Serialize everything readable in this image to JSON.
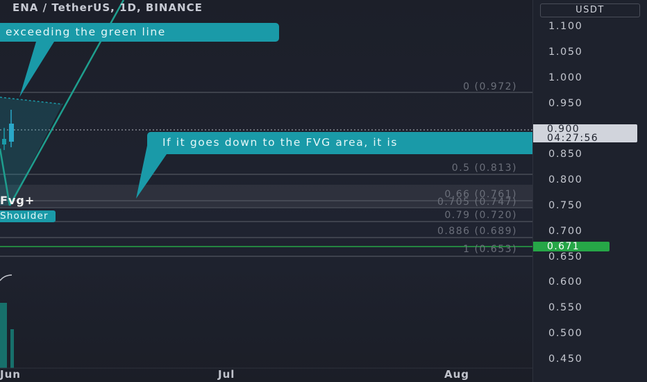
{
  "header": {
    "title": "ENA / TetherUS, 1D, BINANCE"
  },
  "annotations": {
    "bubble_top": "exceeding the green line",
    "bubble_fvg": "If it goes down to the FVG area, it is",
    "fvg_label": "Fvg+",
    "shoulder_label": "Shoulder"
  },
  "fib_levels": [
    {
      "label": "0 (0.972)",
      "price": 0.972
    },
    {
      "label": "0.5 (0.813)",
      "price": 0.813
    },
    {
      "label": "0.66 (0.761)",
      "price": 0.761
    },
    {
      "label": "0.705 (0.747)",
      "price": 0.747
    },
    {
      "label": "0.79 (0.720)",
      "price": 0.72
    },
    {
      "label": "0.886 (0.689)",
      "price": 0.689
    },
    {
      "label": "1 (0.653)",
      "price": 0.653
    }
  ],
  "price_axis": {
    "currency": "USDT",
    "ticks": [
      "1.100",
      "1.050",
      "1.000",
      "0.950",
      "0.850",
      "0.800",
      "0.750",
      "0.700",
      "0.650",
      "0.600",
      "0.550",
      "0.500",
      "0.450"
    ],
    "last_price": "0.900",
    "countdown": "04:27:56",
    "green_line_price": "0.671"
  },
  "time_axis": {
    "labels": [
      "Jun",
      "Jul",
      "Aug"
    ]
  },
  "colors": {
    "background": "#1e222d",
    "teal": "#1a9aa8",
    "green_line": "#26a647",
    "fib_line": "#5d616b"
  }
}
